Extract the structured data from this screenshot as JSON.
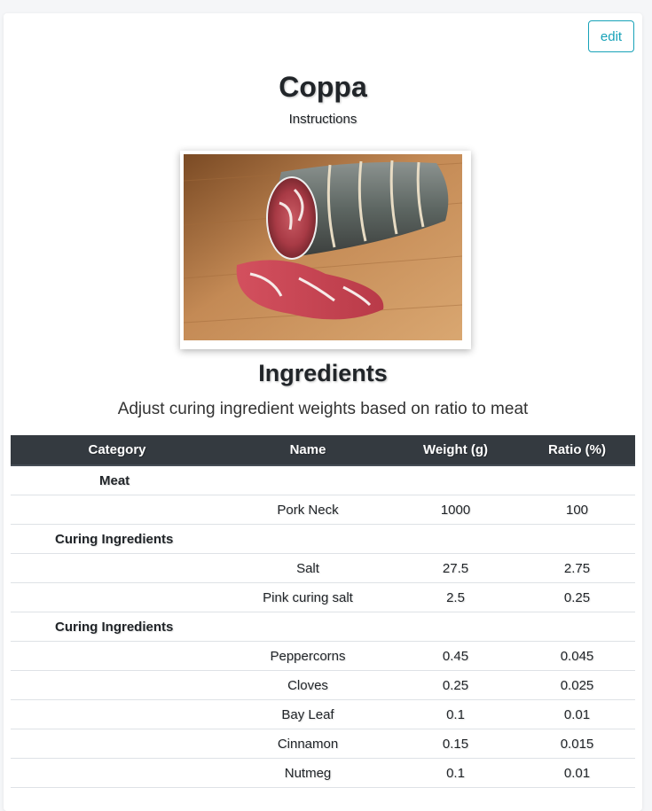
{
  "header": {
    "edit_label": "edit",
    "title": "Coppa",
    "instructions_link": "Instructions"
  },
  "photo": {
    "alt": "Coppa"
  },
  "ingredients": {
    "title": "Ingredients",
    "subtitle": "Adjust curing ingredient weights based on ratio to meat",
    "columns": [
      "Category",
      "Name",
      "Weight (g)",
      "Ratio (%)"
    ],
    "rows": [
      {
        "category": "Meat",
        "name": "",
        "weight": "",
        "ratio": ""
      },
      {
        "category": "",
        "name": "Pork Neck",
        "weight": "1000",
        "ratio": "100"
      },
      {
        "category": "Curing Ingredients",
        "name": "",
        "weight": "",
        "ratio": ""
      },
      {
        "category": "",
        "name": "Salt",
        "weight": "27.5",
        "ratio": "2.75"
      },
      {
        "category": "",
        "name": "Pink curing salt",
        "weight": "2.5",
        "ratio": "0.25"
      },
      {
        "category": "Curing Ingredients",
        "name": "",
        "weight": "",
        "ratio": ""
      },
      {
        "category": "",
        "name": "Peppercorns",
        "weight": "0.45",
        "ratio": "0.045"
      },
      {
        "category": "",
        "name": "Cloves",
        "weight": "0.25",
        "ratio": "0.025"
      },
      {
        "category": "",
        "name": "Bay Leaf",
        "weight": "0.1",
        "ratio": "0.01"
      },
      {
        "category": "",
        "name": "Cinnamon",
        "weight": "0.15",
        "ratio": "0.015"
      },
      {
        "category": "",
        "name": "Nutmeg",
        "weight": "0.1",
        "ratio": "0.01"
      }
    ]
  },
  "colors": {
    "accent": "#17a2b8",
    "table_header": "#343a40",
    "border": "#dee2e6"
  }
}
